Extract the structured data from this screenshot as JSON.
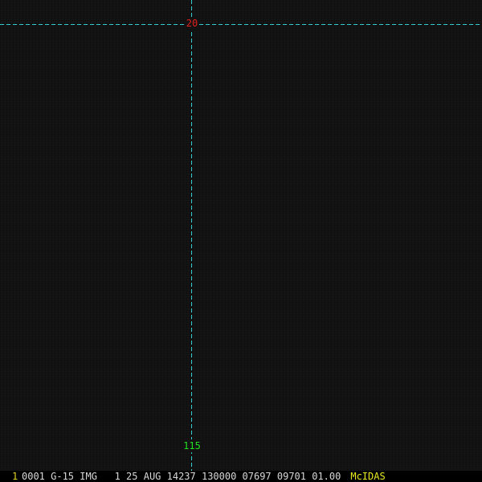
{
  "colors": {
    "gridline": "#34d0d8",
    "latitude_label": "#e02020",
    "longitude_label": "#20e020",
    "frame_number": "#e0d020",
    "status_text": "#d8d8d8",
    "brand": "#e8e820"
  },
  "overlay": {
    "latitude_label": "20",
    "longitude_label": "115"
  },
  "status_bar": {
    "frame_number": "1",
    "image_header": "0001 G-15 IMG   1 25 AUG 14237 130000 07697 09701 01.00",
    "brand": "McIDAS"
  }
}
